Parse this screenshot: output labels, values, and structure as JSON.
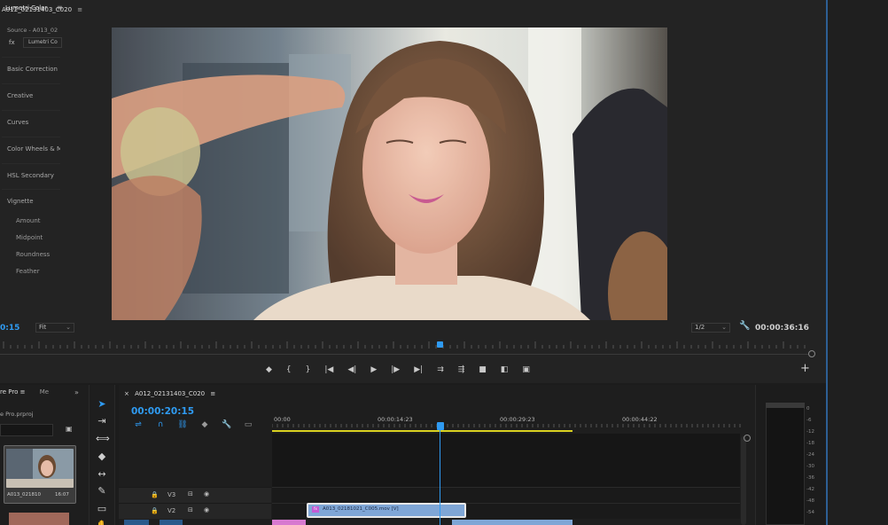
{
  "program_monitor": {
    "tab_title": "A012_02131403_C020",
    "tab_menu": "≡",
    "timecode_left": "0:15",
    "fit_label": "Fit",
    "resolution_label": "1/2",
    "timecode_right": "00:00:36:16",
    "transport": {
      "add_marker": "◆",
      "mark_in": "{",
      "mark_out": "}",
      "go_to_in": "|◀",
      "step_back": "◀|",
      "play": "▶",
      "step_forward": "|▶",
      "go_to_out": "▶|",
      "insert": "⇉",
      "overwrite": "⇶",
      "export_frame": "■",
      "compare_view": "◧",
      "proxy_toggle": "▣",
      "plus": "+"
    }
  },
  "lumetri": {
    "tab_title": "Lumetri Color",
    "close": "≡",
    "source_label": "Source - A013_02",
    "fx_label": "fx",
    "effect_select": "Lumetri Co",
    "sections": [
      "Basic Correction",
      "Creative",
      "Curves",
      "Color Wheels & M",
      "HSL Secondary",
      "Vignette"
    ],
    "vignette_params": [
      "Amount",
      "Midpoint",
      "Roundness",
      "Feather"
    ]
  },
  "project": {
    "tab_label": "re Pro",
    "tab_menu": "≡",
    "tab_inactive": "Me",
    "tab_arrows": "»",
    "project_name": "e Pro.prproj",
    "folder_icon": "▣",
    "thumb_label": "A013_021810",
    "thumb_duration": "16:07"
  },
  "tools": [
    "selection-tool",
    "track-select-tool",
    "ripple-edit-tool",
    "razor-tool",
    "slip-tool",
    "pen-tool",
    "rectangle-tool"
  ],
  "timeline": {
    "sequence_tab": "A012_02131403_C020",
    "sequence_menu": "≡",
    "close_x": "×",
    "timecode": "00:00:20:15",
    "ruler_ticks": [
      "00:00",
      "00:00:14:23",
      "00:00:29:23",
      "00:00:44:22"
    ],
    "tracks": [
      {
        "name": "V3"
      },
      {
        "name": "V2"
      }
    ],
    "clip_label": "A013_02181021_C005.mov [V]",
    "clip_fx": "fx"
  },
  "audio_meter": {
    "labels": [
      "0",
      "-6",
      "-12",
      "-18",
      "-24",
      "-30",
      "-36",
      "-42",
      "-48",
      "-54"
    ]
  },
  "colors": {
    "accent_blue": "#2f9bf2",
    "work_area_yellow": "#d8d020",
    "clip_blue": "#7fa6d6",
    "clip_pink": "#d77ad0"
  }
}
